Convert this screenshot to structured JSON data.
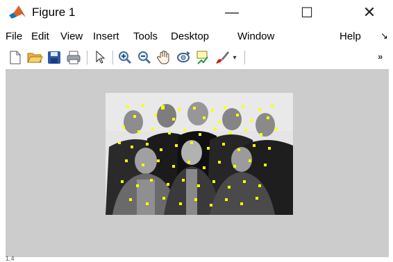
{
  "window": {
    "title": "Figure 1",
    "controls": {
      "minimize": "—",
      "maximize": "☐",
      "close": "✕"
    }
  },
  "menu": {
    "items": [
      "File",
      "Edit",
      "View",
      "Insert",
      "Tools",
      "Desktop",
      "Window",
      "Help"
    ],
    "overflow": "↘"
  },
  "toolbar": {
    "buttons": [
      "new-figure-icon",
      "open-file-icon",
      "save-icon",
      "print-icon",
      "pointer-arrow-icon",
      "zoom-in-icon",
      "zoom-out-icon",
      "pan-hand-icon",
      "rotate-3d-icon",
      "data-cursor-icon",
      "brush-icon",
      "dropdown-arrow-icon"
    ],
    "overflow": "»"
  },
  "figure": {
    "background": "#cccccc",
    "image_subject": "grayscale group photo with yellow feature-point markers",
    "marker_color": "#ffff00"
  },
  "footer": {
    "text": "1.4"
  }
}
